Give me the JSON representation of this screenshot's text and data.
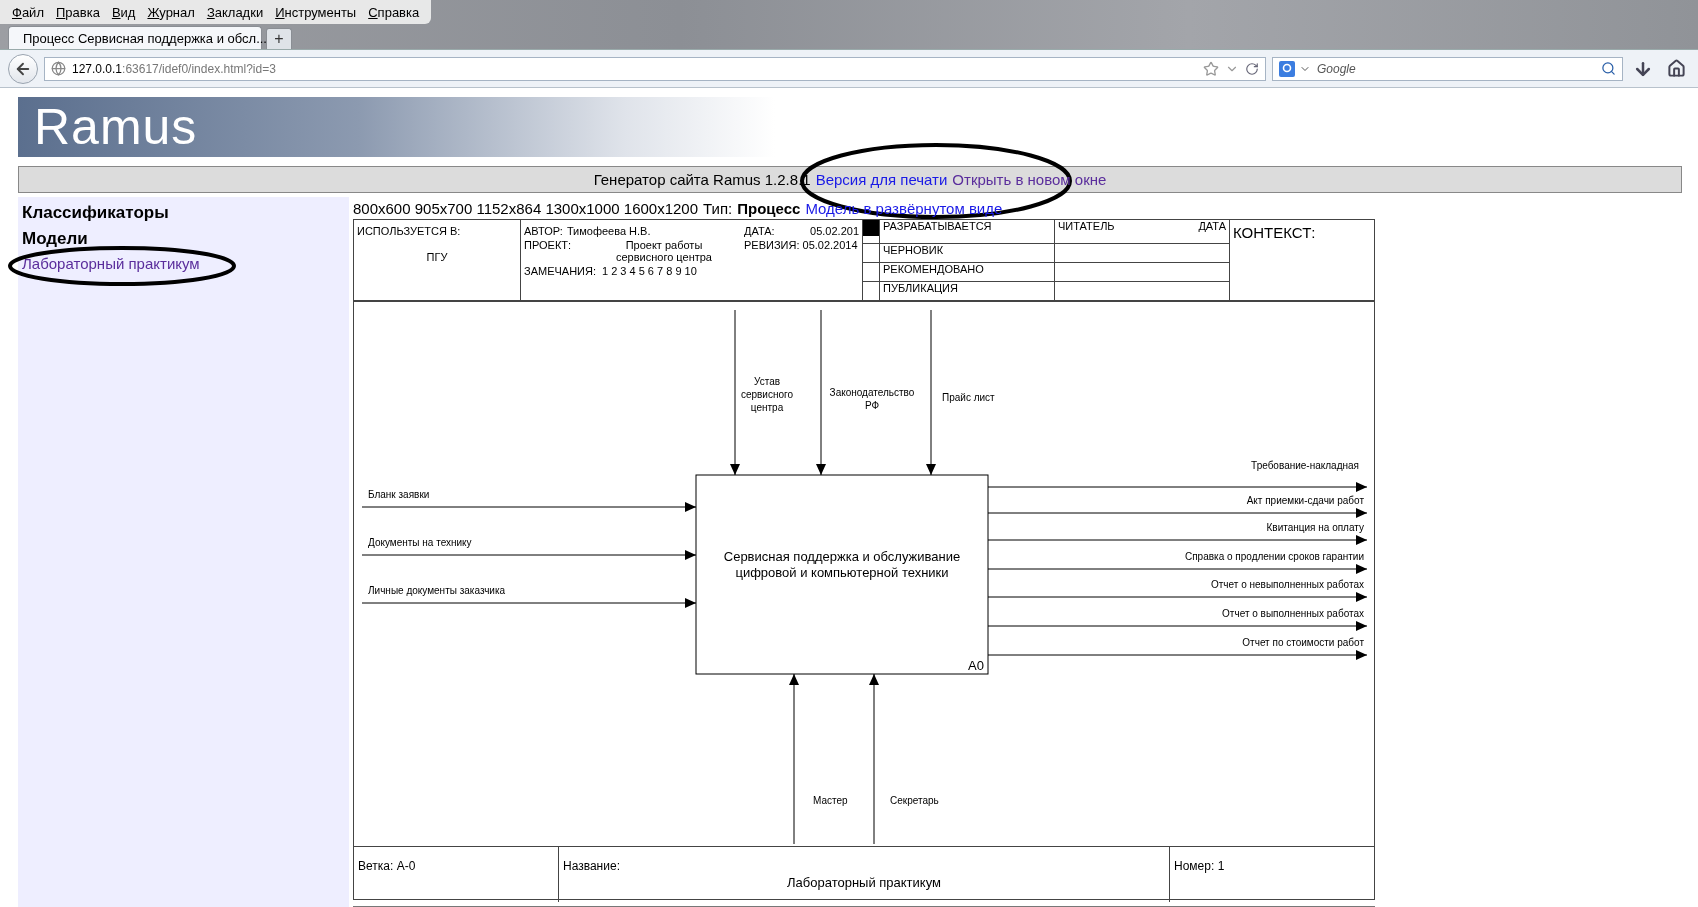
{
  "browser": {
    "menu": [
      "Файл",
      "Правка",
      "Вид",
      "Журнал",
      "Закладки",
      "Инструменты",
      "Справка"
    ],
    "tabs": [
      {
        "title": "Процесс Сервисная поддержка и обсл...",
        "selected": true
      }
    ],
    "new_tab": "+",
    "url": {
      "host": "127.0.0.1",
      "rest": ":63617/idef0/index.html?id=3"
    },
    "search": {
      "placeholder": "Google"
    }
  },
  "banner": {
    "logo": "Ramus"
  },
  "generator_bar": {
    "text": "Генератор сайта Ramus 1.2.8.1",
    "links": [
      {
        "label": "Версия для печати",
        "visited": false
      },
      {
        "label": "Открыть в новом окне",
        "visited": true
      }
    ]
  },
  "sidebar": {
    "headings": [
      "Классификаторы",
      "Модели"
    ],
    "links": [
      {
        "label": "Лабораторный практикум",
        "visited": true
      }
    ]
  },
  "toolbar": {
    "sizes": "800x600 905x700 1152x864 1300x1000 1600x1200",
    "type_label": "Тип:",
    "type_value": "Процесс",
    "link": {
      "label": "Модель в развёрнутом виде",
      "visited": false
    }
  },
  "header": {
    "used_in_label": "ИСПОЛЬЗУЕТСЯ В:",
    "used_in": "ПГУ",
    "author_label": "АВТОР:",
    "author": "Тимофеева Н.В.",
    "date_label": "ДАТА:",
    "date": "05.02.201",
    "project_label": "ПРОЕКТ:",
    "project": "Проект работы сервисного центра",
    "revision_label": "РЕВИЗИЯ:",
    "revision": "05.02.2014",
    "notes_label": "ЗАМЕЧАНИЯ:",
    "notes": "1 2 3 4 5 6 7 8 9 10",
    "statuses": [
      {
        "label": "РАЗРАБАТЫВАЕТСЯ",
        "selected": true
      },
      {
        "label": "ЧЕРНОВИК",
        "selected": false
      },
      {
        "label": "РЕКОМЕНДОВАНО",
        "selected": false
      },
      {
        "label": "ПУБЛИКАЦИЯ",
        "selected": false
      }
    ],
    "reader_label": "ЧИТАТЕЛЬ",
    "reader_date_label": "ДАТА",
    "context_label": "КОНТЕКСТ:"
  },
  "diagram": {
    "box": {
      "lines": [
        "Сервисная поддержка и обслуживание",
        "цифровой и компьютерной техники"
      ],
      "node": "A0"
    },
    "controls": [
      {
        "lines": [
          "Устав",
          "сервисного",
          "центра"
        ]
      },
      {
        "lines": [
          "Законодательство",
          "РФ"
        ]
      },
      {
        "lines": [
          "Прайс лист"
        ]
      }
    ],
    "inputs": [
      {
        "lines": [
          "Бланк заявки"
        ]
      },
      {
        "lines": [
          "Документы на технику"
        ]
      },
      {
        "lines": [
          "Личные документы заказчика"
        ]
      }
    ],
    "outputs": [
      {
        "lines": [
          "Требование-накладная"
        ]
      },
      {
        "lines": [
          "Акт приемки-сдачи работ"
        ]
      },
      {
        "lines": [
          "Квитанция на оплату"
        ]
      },
      {
        "lines": [
          "Справка о продлении сроков гарантии"
        ]
      },
      {
        "lines": [
          "Отчет о невыполненных работах"
        ]
      },
      {
        "lines": [
          "Отчет о выполненных работах"
        ]
      },
      {
        "lines": [
          "Отчет по стоимости работ"
        ]
      }
    ],
    "mechanisms": [
      {
        "lines": [
          "Мастер"
        ]
      },
      {
        "lines": [
          "Секретарь"
        ]
      }
    ]
  },
  "footer": {
    "node_label": "Ветка:",
    "node": "А-0",
    "title_label": "Название:",
    "title": "Лабораторный практикум",
    "number_label": "Номер:",
    "number": "1"
  }
}
